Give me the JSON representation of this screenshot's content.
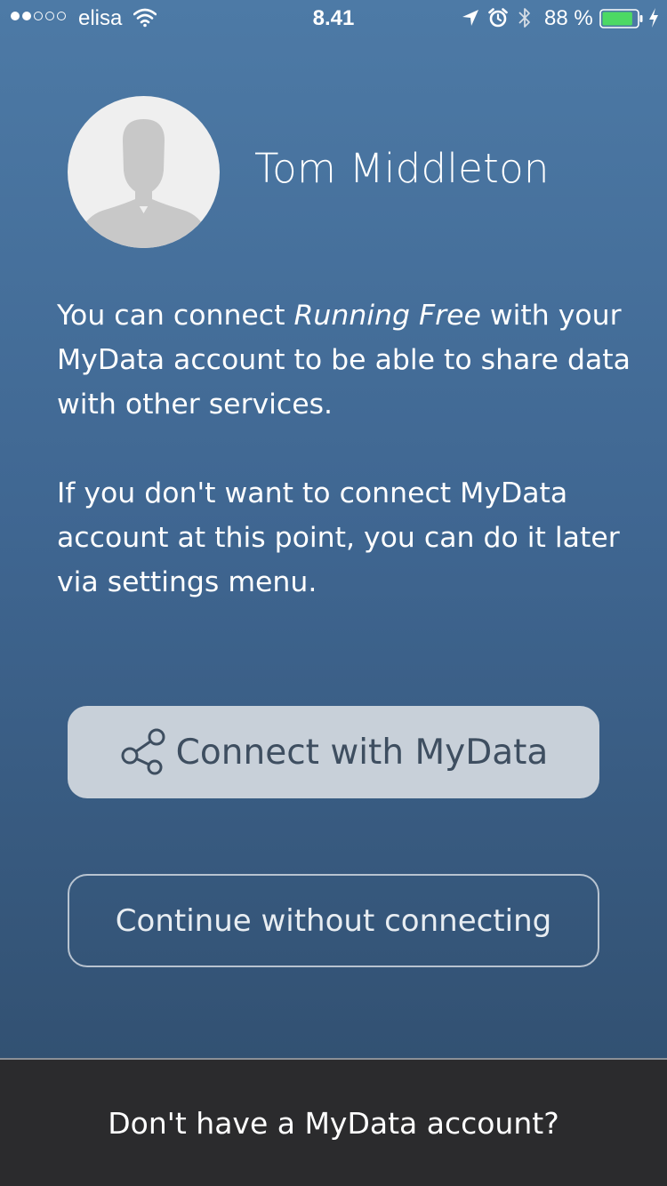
{
  "status_bar": {
    "signal_filled": 2,
    "signal_total": 5,
    "carrier": "elisa",
    "time": "8.41",
    "battery_percent": "88 %",
    "battery_level": 0.88,
    "icons": [
      "wifi-icon",
      "location-icon",
      "alarm-icon",
      "bluetooth-icon",
      "battery-icon",
      "charging-icon"
    ]
  },
  "profile": {
    "name": "Tom Middleton",
    "avatar_icon": "default-avatar-icon"
  },
  "description": {
    "p1_before": "You can connect ",
    "p1_app_name": "Running Free",
    "p1_after": " with your MyData account to be able to share data with other services.",
    "p2": "If you don't want to connect MyData account at this point, you can do it later via settings menu."
  },
  "buttons": {
    "connect_label": "Connect with MyData",
    "connect_icon": "share-icon",
    "continue_label": "Continue without connecting"
  },
  "footer": {
    "no_account_label": "Don't have a MyData account?"
  },
  "colors": {
    "background_top": "#4d7aa6",
    "background_bottom": "#2f4c6b",
    "connect_button_bg": "#c8d0d9",
    "connect_button_text": "#3e4e60",
    "footer_bg": "#2b2b2d",
    "battery_fill": "#4cd964"
  }
}
